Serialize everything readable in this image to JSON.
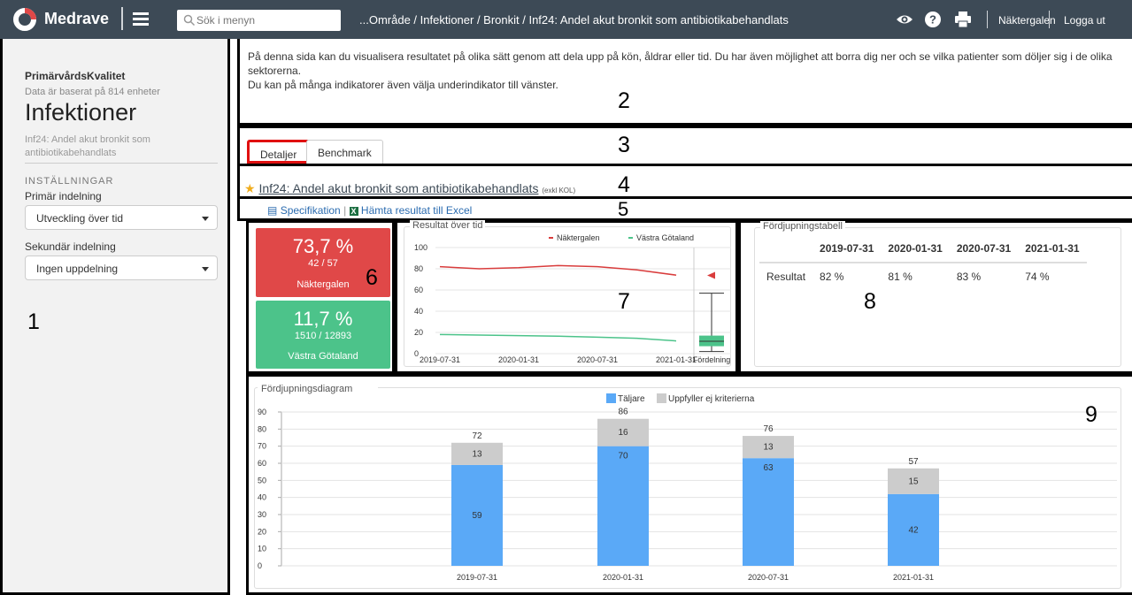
{
  "topbar": {
    "brand": "Medrave",
    "search_placeholder": "Sök i menyn",
    "breadcrumb": "...Område / Infektioner / Bronkit / Inf24: Andel akut bronkit som antibiotikabehandlats",
    "user": "Näktergalen",
    "logout": "Logga ut",
    "icons": [
      "eye-icon",
      "help-icon",
      "print-icon"
    ]
  },
  "sidebar": {
    "org": "PrimärvårdsKvalitet",
    "units_note": "Data är baserat på 814 enheter",
    "title": "Infektioner",
    "indicator": "Inf24: Andel akut bronkit som antibiotikabehandlats",
    "settings_heading": "INSTÄLLNINGAR",
    "primary_label": "Primär indelning",
    "primary_value": "Utveckling över tid",
    "secondary_label": "Sekundär indelning",
    "secondary_value": "Ingen uppdelning"
  },
  "annotations": [
    "1",
    "2",
    "3",
    "4",
    "5",
    "6",
    "7",
    "8",
    "9"
  ],
  "intro": {
    "line1": "På denna sida kan du visualisera resultatet på olika sätt genom att dela upp på kön, åldrar eller tid. Du har även möjlighet att borra dig ner och se vilka patienter som döljer sig i de olika sektorerna.",
    "line2": "Du kan på många indikatorer även välja underindikator till vänster."
  },
  "tabs": [
    {
      "label": "Detaljer",
      "active": true
    },
    {
      "label": "Benchmark",
      "active": false
    }
  ],
  "indicator": {
    "title": "Inf24: Andel akut bronkit som antibiotikabehandlats",
    "note": "(exkl KOL)",
    "spec_link": "Specifikation",
    "excel_link": "Hämta resultat till Excel"
  },
  "tiles": [
    {
      "pct": "73,7 %",
      "frac": "42 / 57",
      "name": "Näktergalen",
      "color": "#e04848"
    },
    {
      "pct": "11,7 %",
      "frac": "1510 / 12893",
      "name": "Västra Götaland",
      "color": "#4cc38a"
    }
  ],
  "trend_chart": {
    "title": "Resultat över tid",
    "legend": [
      "Näktergalen",
      "Västra Götaland"
    ],
    "yticks": [
      "100",
      "80",
      "60",
      "40",
      "20",
      "0"
    ],
    "xticks": [
      "2019-07-31",
      "2020-01-31",
      "2020-07-31",
      "2021-01-31"
    ],
    "dist_label": "Fördelning"
  },
  "table": {
    "title": "Fördjupningstabell",
    "columns": [
      "2019-07-31",
      "2020-01-31",
      "2020-07-31",
      "2021-01-31"
    ],
    "row_label": "Resultat",
    "values": [
      "82 %",
      "81 %",
      "83 %",
      "74 %"
    ]
  },
  "chart_data": [
    {
      "type": "line",
      "title": "Resultat över tid",
      "x": [
        "2019-07-31",
        "2019-10-31",
        "2020-01-31",
        "2020-04-30",
        "2020-07-31",
        "2020-10-31",
        "2021-01-31"
      ],
      "series": [
        {
          "name": "Näktergalen",
          "color": "#d93c3c",
          "values": [
            82,
            80,
            81,
            83,
            82,
            79,
            74
          ]
        },
        {
          "name": "Västra Götaland",
          "color": "#4cc38a",
          "values": [
            18,
            17.5,
            17,
            16.5,
            15.5,
            14.5,
            12
          ]
        }
      ],
      "ylim": [
        0,
        100
      ],
      "extra_category": "Fördelning"
    },
    {
      "type": "bar",
      "title": "Fördjupningsdiagram",
      "stacked": true,
      "categories": [
        "2019-07-31",
        "2020-01-31",
        "2020-07-31",
        "2021-01-31"
      ],
      "series": [
        {
          "name": "Täljare",
          "color": "#5aa9f7",
          "values": [
            59,
            70,
            63,
            42
          ]
        },
        {
          "name": "Uppfyller ej kriterierna",
          "color": "#cccccc",
          "values": [
            13,
            16,
            13,
            15
          ]
        }
      ],
      "totals": [
        72,
        86,
        76,
        57
      ],
      "ylim": [
        0,
        90
      ],
      "yticks": [
        0,
        10,
        20,
        30,
        40,
        50,
        60,
        70,
        80,
        90
      ]
    }
  ]
}
